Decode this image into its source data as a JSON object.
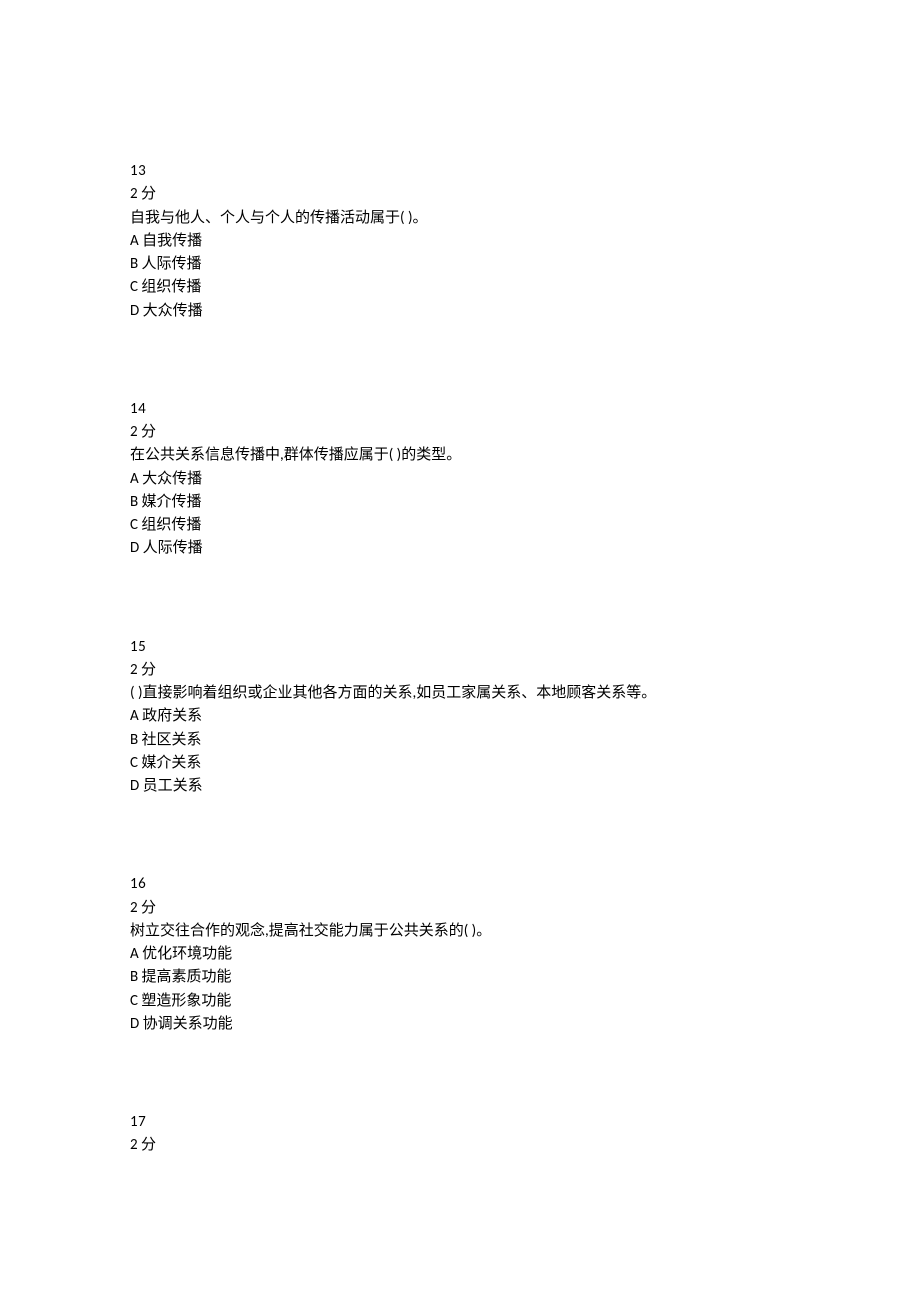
{
  "questions": [
    {
      "number": "13",
      "points": "2 分",
      "stem": "自我与他人、个人与个人的传播活动属于( )。",
      "options": [
        "A 自我传播",
        "B 人际传播",
        "C 组织传播",
        "D 大众传播"
      ]
    },
    {
      "number": "14",
      "points": "2 分",
      "stem": "在公共关系信息传播中,群体传播应属于( )的类型。",
      "options": [
        "A 大众传播",
        "B 媒介传播",
        "C 组织传播",
        "D 人际传播"
      ]
    },
    {
      "number": "15",
      "points": "2 分",
      "stem": "( )直接影响着组织或企业其他各方面的关系,如员工家属关系、本地顾客关系等。",
      "options": [
        "A 政府关系",
        "B 社区关系",
        "C 媒介关系",
        "D 员工关系"
      ]
    },
    {
      "number": "16",
      "points": "2 分",
      "stem": "树立交往合作的观念,提高社交能力属于公共关系的( )。",
      "options": [
        "A 优化环境功能",
        "B 提高素质功能",
        "C 塑造形象功能",
        "D 协调关系功能"
      ]
    },
    {
      "number": "17",
      "points": "2 分",
      "stem": "",
      "options": []
    }
  ]
}
